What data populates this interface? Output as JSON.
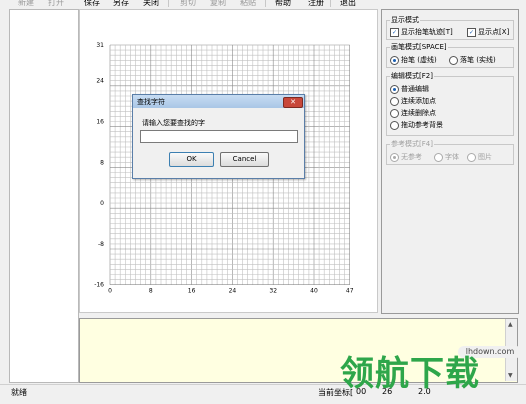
{
  "toolbar": {
    "items": [
      {
        "label": "新建",
        "enabled": false
      },
      {
        "label": "打开",
        "enabled": false
      },
      {
        "label": "保存",
        "enabled": true
      },
      {
        "label": "另存",
        "enabled": true
      },
      {
        "label": "关闭",
        "enabled": true
      },
      {
        "label": "剪切",
        "enabled": false
      },
      {
        "label": "复制",
        "enabled": false
      },
      {
        "label": "粘贴",
        "enabled": false
      },
      {
        "label": "帮助",
        "enabled": true
      },
      {
        "label": "注册",
        "enabled": true
      },
      {
        "label": "退出",
        "enabled": true
      }
    ]
  },
  "canvas": {
    "y_ticks": [
      "31",
      "24",
      "16",
      "8",
      "0",
      "-8",
      "-16"
    ],
    "x_ticks": [
      "0",
      "8",
      "16",
      "24",
      "32",
      "40",
      "47"
    ],
    "grid_color": "#c0c0c0"
  },
  "right_panel": {
    "display_mode": {
      "title": "显示模式",
      "options": [
        {
          "label": "显示抬笔轨迹[T]",
          "checked": true
        },
        {
          "label": "显示点[X]",
          "checked": true
        }
      ]
    },
    "pen_mode": {
      "title": "画笔模式[SPACE]",
      "options": [
        {
          "label": "抬笔 (虚线)",
          "selected": true
        },
        {
          "label": "落笔 (实线)",
          "selected": false
        }
      ]
    },
    "edit_mode": {
      "title": "编辑模式[F2]",
      "options": [
        {
          "label": "普通编辑",
          "selected": true
        },
        {
          "label": "连续添加点",
          "selected": false
        },
        {
          "label": "连续删除点",
          "selected": false
        },
        {
          "label": "拖动参考背景",
          "selected": false
        }
      ]
    },
    "reference_mode": {
      "title": "参考模式[F4]",
      "enabled": false,
      "options": [
        {
          "label": "无参考",
          "selected": true
        },
        {
          "label": "字体",
          "selected": false
        },
        {
          "label": "图片",
          "selected": false
        }
      ]
    }
  },
  "dialog": {
    "title": "查找字符",
    "prompt": "请输入您要查找的字",
    "input_value": "",
    "ok_label": "OK",
    "cancel_label": "Cancel",
    "close_glyph": "✕"
  },
  "statusbar": {
    "left": "就绪",
    "right": "当前坐标[",
    "right_fragments": [
      "00",
      "26",
      "2.0"
    ]
  },
  "watermark": {
    "badge": "lhdown.com",
    "text": "领航下载"
  },
  "colors": {
    "bottom_area_bg": "#ffffe1",
    "accent": "#1a5fb4",
    "watermark_green": "#2ea64a"
  }
}
